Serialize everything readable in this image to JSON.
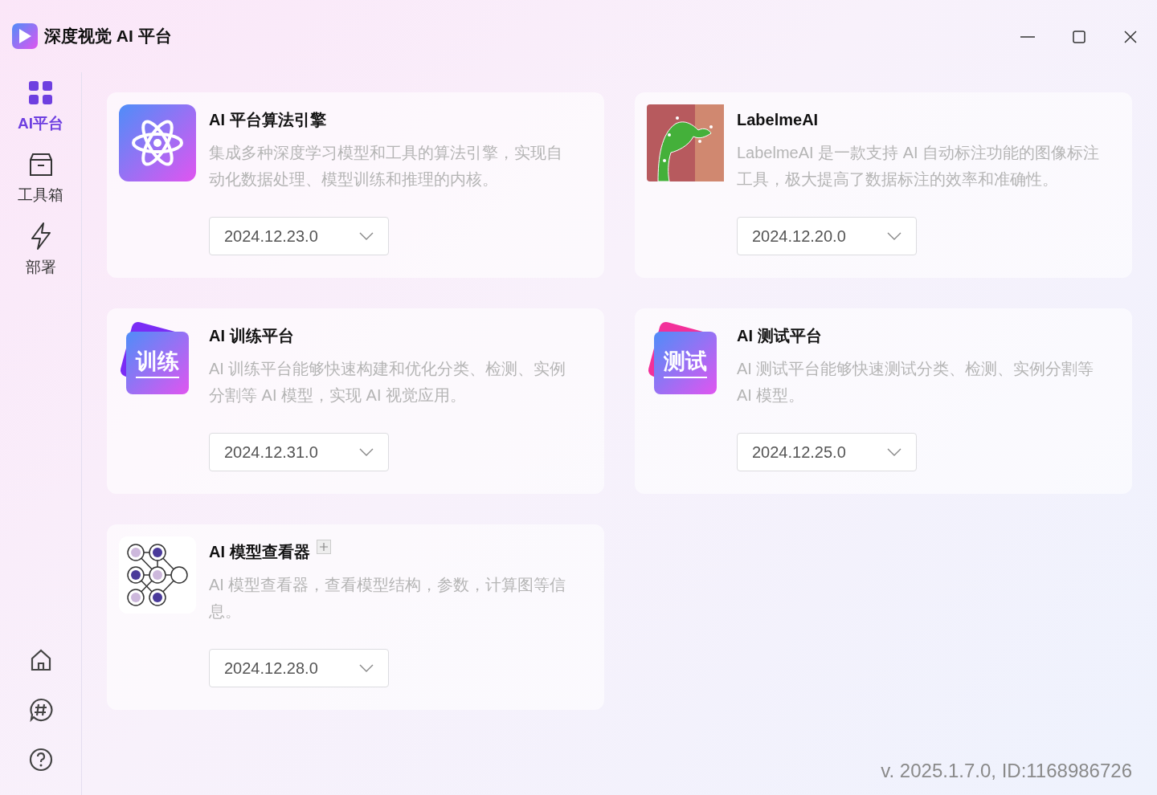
{
  "window": {
    "title": "深度视觉 AI 平台"
  },
  "sidebar": {
    "items": [
      {
        "label": "AI平台",
        "selected": true
      },
      {
        "label": "工具箱",
        "selected": false
      },
      {
        "label": "部署",
        "selected": false
      }
    ]
  },
  "cards": [
    {
      "icon": {
        "kind": "atom"
      },
      "title": "AI 平台算法引擎",
      "add_mark": false,
      "description": "集成多种深度学习模型和工具的算法引擎，实现自动化数据处理、模型训练和推理的内核。",
      "version": "2024.12.23.0"
    },
    {
      "icon": {
        "kind": "photo"
      },
      "title": "LabelmeAI",
      "add_mark": false,
      "description": "LabelmeAI 是一款支持 AI 自动标注功能的图像标注工具，极大提高了数据标注的效率和准确性。",
      "version": "2024.12.20.0"
    },
    {
      "icon": {
        "kind": "text",
        "text": "训练",
        "color": "#7a2cf5"
      },
      "title": "AI 训练平台",
      "add_mark": false,
      "description": "AI 训练平台能够快速构建和优化分类、检测、实例分割等 AI 模型，实现 AI 视觉应用。",
      "version": "2024.12.31.0"
    },
    {
      "icon": {
        "kind": "text",
        "text": "测试",
        "color": "#f2309a"
      },
      "title": "AI 测试平台",
      "add_mark": false,
      "description": "AI 测试平台能够快速测试分类、检测、实例分割等 AI 模型。",
      "version": "2024.12.25.0"
    },
    {
      "icon": {
        "kind": "network"
      },
      "title": "AI 模型查看器",
      "add_mark": true,
      "description": "AI 模型查看器，查看模型结构，参数，计算图等信息。",
      "version": "2024.12.28.0"
    }
  ],
  "status_bar": {
    "version": "v. 2025.1.7.0, ID:1168986726"
  }
}
